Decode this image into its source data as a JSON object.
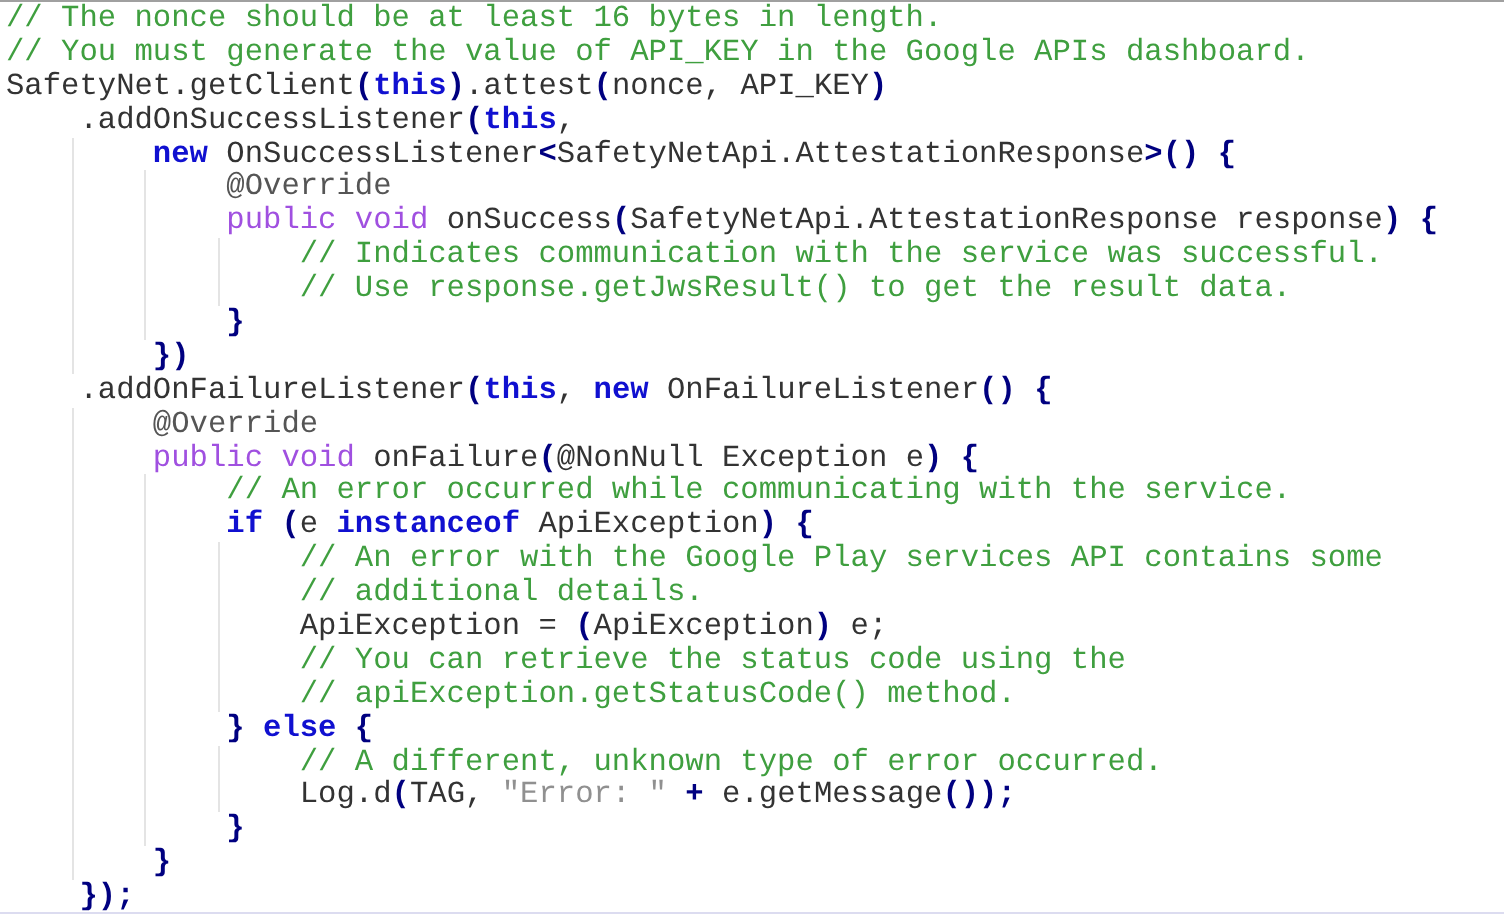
{
  "code_lines": [
    {
      "tokens": [
        {
          "kind": "comment",
          "text": "// The nonce should be at least 16 bytes in length."
        }
      ]
    },
    {
      "tokens": [
        {
          "kind": "comment",
          "text": "// You must generate the value of API_KEY in the Google APIs dashboard."
        }
      ]
    },
    {
      "tokens": [
        {
          "kind": "plain",
          "text": "SafetyNet.getClient"
        },
        {
          "kind": "punct",
          "text": "("
        },
        {
          "kind": "keyword",
          "text": "this"
        },
        {
          "kind": "punct",
          "text": ")"
        },
        {
          "kind": "plain",
          "text": ".attest"
        },
        {
          "kind": "punct",
          "text": "("
        },
        {
          "kind": "plain",
          "text": "nonce, API_KEY"
        },
        {
          "kind": "punct",
          "text": ")"
        }
      ]
    },
    {
      "tokens": [
        {
          "kind": "plain",
          "text": "    .addOnSuccessListener"
        },
        {
          "kind": "punct",
          "text": "("
        },
        {
          "kind": "keyword",
          "text": "this"
        },
        {
          "kind": "plain",
          "text": ","
        }
      ]
    },
    {
      "tokens": [
        {
          "kind": "keyword",
          "text": "        new"
        },
        {
          "kind": "plain",
          "text": " OnSuccessListener"
        },
        {
          "kind": "punct",
          "text": "<"
        },
        {
          "kind": "plain",
          "text": "SafetyNetApi.AttestationResponse"
        },
        {
          "kind": "punct",
          "text": ">() {"
        }
      ]
    },
    {
      "tokens": [
        {
          "kind": "annotation",
          "text": "            @Override"
        }
      ]
    },
    {
      "tokens": [
        {
          "kind": "modifier",
          "text": "            public void"
        },
        {
          "kind": "plain",
          "text": " onSuccess"
        },
        {
          "kind": "punct",
          "text": "("
        },
        {
          "kind": "plain",
          "text": "SafetyNetApi.AttestationResponse response"
        },
        {
          "kind": "punct",
          "text": ") {"
        }
      ]
    },
    {
      "tokens": [
        {
          "kind": "comment",
          "text": "                // Indicates communication with the service was successful."
        }
      ]
    },
    {
      "tokens": [
        {
          "kind": "comment",
          "text": "                // Use response.getJwsResult() to get the result data."
        }
      ]
    },
    {
      "tokens": [
        {
          "kind": "punct",
          "text": "            }"
        }
      ]
    },
    {
      "tokens": [
        {
          "kind": "punct",
          "text": "        })"
        }
      ]
    },
    {
      "tokens": [
        {
          "kind": "plain",
          "text": "    .addOnFailureListener"
        },
        {
          "kind": "punct",
          "text": "("
        },
        {
          "kind": "keyword",
          "text": "this"
        },
        {
          "kind": "plain",
          "text": ", "
        },
        {
          "kind": "keyword",
          "text": "new"
        },
        {
          "kind": "plain",
          "text": " OnFailureListener"
        },
        {
          "kind": "punct",
          "text": "() {"
        }
      ]
    },
    {
      "tokens": [
        {
          "kind": "annotation",
          "text": "        @Override"
        }
      ]
    },
    {
      "tokens": [
        {
          "kind": "modifier",
          "text": "        public void"
        },
        {
          "kind": "plain",
          "text": " onFailure"
        },
        {
          "kind": "punct",
          "text": "("
        },
        {
          "kind": "plain",
          "text": "@NonNull Exception e"
        },
        {
          "kind": "punct",
          "text": ") {"
        }
      ]
    },
    {
      "tokens": [
        {
          "kind": "comment",
          "text": "            // An error occurred while communicating with the service."
        }
      ]
    },
    {
      "tokens": [
        {
          "kind": "keyword",
          "text": "            if"
        },
        {
          "kind": "punct",
          "text": " ("
        },
        {
          "kind": "plain",
          "text": "e "
        },
        {
          "kind": "keyword",
          "text": "instanceof"
        },
        {
          "kind": "plain",
          "text": " ApiException"
        },
        {
          "kind": "punct",
          "text": ") {"
        }
      ]
    },
    {
      "tokens": [
        {
          "kind": "comment",
          "text": "                // An error with the Google Play services API contains some"
        }
      ]
    },
    {
      "tokens": [
        {
          "kind": "comment",
          "text": "                // additional details."
        }
      ]
    },
    {
      "tokens": [
        {
          "kind": "plain",
          "text": "                ApiException = "
        },
        {
          "kind": "punct",
          "text": "("
        },
        {
          "kind": "plain",
          "text": "ApiException"
        },
        {
          "kind": "punct",
          "text": ")"
        },
        {
          "kind": "plain",
          "text": " e;"
        }
      ]
    },
    {
      "tokens": [
        {
          "kind": "comment",
          "text": "                // You can retrieve the status code using the"
        }
      ]
    },
    {
      "tokens": [
        {
          "kind": "comment",
          "text": "                // apiException.getStatusCode() method."
        }
      ]
    },
    {
      "tokens": [
        {
          "kind": "punct",
          "text": "            }"
        },
        {
          "kind": "keyword",
          "text": " else "
        },
        {
          "kind": "punct",
          "text": "{"
        }
      ]
    },
    {
      "tokens": [
        {
          "kind": "comment",
          "text": "                // A different, unknown type of error occurred."
        }
      ]
    },
    {
      "tokens": [
        {
          "kind": "plain",
          "text": "                Log.d"
        },
        {
          "kind": "punct",
          "text": "("
        },
        {
          "kind": "plain",
          "text": "TAG, "
        },
        {
          "kind": "string",
          "text": "\"Error: \""
        },
        {
          "kind": "punct",
          "text": " + "
        },
        {
          "kind": "plain",
          "text": "e.getMessage"
        },
        {
          "kind": "punct",
          "text": "());"
        }
      ]
    },
    {
      "tokens": [
        {
          "kind": "punct",
          "text": "            }"
        }
      ]
    },
    {
      "tokens": [
        {
          "kind": "punct",
          "text": "        }"
        }
      ]
    },
    {
      "tokens": [
        {
          "kind": "punct",
          "text": "    });"
        }
      ]
    }
  ]
}
